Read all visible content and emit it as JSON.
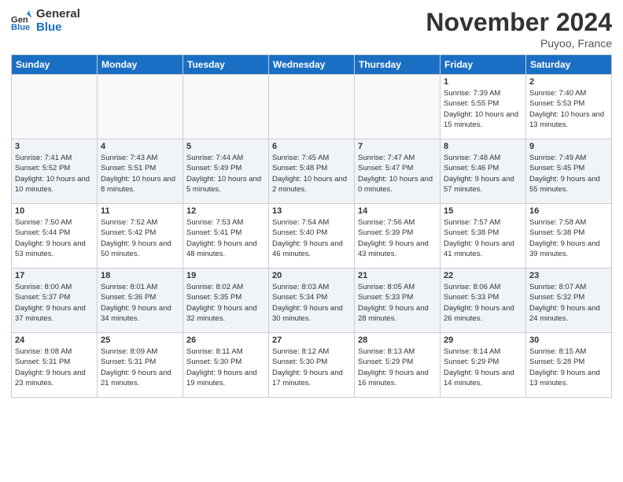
{
  "header": {
    "logo_line1": "General",
    "logo_line2": "Blue",
    "month": "November 2024",
    "location": "Puyoo, France"
  },
  "days_of_week": [
    "Sunday",
    "Monday",
    "Tuesday",
    "Wednesday",
    "Thursday",
    "Friday",
    "Saturday"
  ],
  "weeks": [
    [
      {
        "day": "",
        "info": ""
      },
      {
        "day": "",
        "info": ""
      },
      {
        "day": "",
        "info": ""
      },
      {
        "day": "",
        "info": ""
      },
      {
        "day": "",
        "info": ""
      },
      {
        "day": "1",
        "info": "Sunrise: 7:39 AM\nSunset: 5:55 PM\nDaylight: 10 hours and 15 minutes."
      },
      {
        "day": "2",
        "info": "Sunrise: 7:40 AM\nSunset: 5:53 PM\nDaylight: 10 hours and 13 minutes."
      }
    ],
    [
      {
        "day": "3",
        "info": "Sunrise: 7:41 AM\nSunset: 5:52 PM\nDaylight: 10 hours and 10 minutes."
      },
      {
        "day": "4",
        "info": "Sunrise: 7:43 AM\nSunset: 5:51 PM\nDaylight: 10 hours and 8 minutes."
      },
      {
        "day": "5",
        "info": "Sunrise: 7:44 AM\nSunset: 5:49 PM\nDaylight: 10 hours and 5 minutes."
      },
      {
        "day": "6",
        "info": "Sunrise: 7:45 AM\nSunset: 5:48 PM\nDaylight: 10 hours and 2 minutes."
      },
      {
        "day": "7",
        "info": "Sunrise: 7:47 AM\nSunset: 5:47 PM\nDaylight: 10 hours and 0 minutes."
      },
      {
        "day": "8",
        "info": "Sunrise: 7:48 AM\nSunset: 5:46 PM\nDaylight: 9 hours and 57 minutes."
      },
      {
        "day": "9",
        "info": "Sunrise: 7:49 AM\nSunset: 5:45 PM\nDaylight: 9 hours and 55 minutes."
      }
    ],
    [
      {
        "day": "10",
        "info": "Sunrise: 7:50 AM\nSunset: 5:44 PM\nDaylight: 9 hours and 53 minutes."
      },
      {
        "day": "11",
        "info": "Sunrise: 7:52 AM\nSunset: 5:42 PM\nDaylight: 9 hours and 50 minutes."
      },
      {
        "day": "12",
        "info": "Sunrise: 7:53 AM\nSunset: 5:41 PM\nDaylight: 9 hours and 48 minutes."
      },
      {
        "day": "13",
        "info": "Sunrise: 7:54 AM\nSunset: 5:40 PM\nDaylight: 9 hours and 46 minutes."
      },
      {
        "day": "14",
        "info": "Sunrise: 7:56 AM\nSunset: 5:39 PM\nDaylight: 9 hours and 43 minutes."
      },
      {
        "day": "15",
        "info": "Sunrise: 7:57 AM\nSunset: 5:38 PM\nDaylight: 9 hours and 41 minutes."
      },
      {
        "day": "16",
        "info": "Sunrise: 7:58 AM\nSunset: 5:38 PM\nDaylight: 9 hours and 39 minutes."
      }
    ],
    [
      {
        "day": "17",
        "info": "Sunrise: 8:00 AM\nSunset: 5:37 PM\nDaylight: 9 hours and 37 minutes."
      },
      {
        "day": "18",
        "info": "Sunrise: 8:01 AM\nSunset: 5:36 PM\nDaylight: 9 hours and 34 minutes."
      },
      {
        "day": "19",
        "info": "Sunrise: 8:02 AM\nSunset: 5:35 PM\nDaylight: 9 hours and 32 minutes."
      },
      {
        "day": "20",
        "info": "Sunrise: 8:03 AM\nSunset: 5:34 PM\nDaylight: 9 hours and 30 minutes."
      },
      {
        "day": "21",
        "info": "Sunrise: 8:05 AM\nSunset: 5:33 PM\nDaylight: 9 hours and 28 minutes."
      },
      {
        "day": "22",
        "info": "Sunrise: 8:06 AM\nSunset: 5:33 PM\nDaylight: 9 hours and 26 minutes."
      },
      {
        "day": "23",
        "info": "Sunrise: 8:07 AM\nSunset: 5:32 PM\nDaylight: 9 hours and 24 minutes."
      }
    ],
    [
      {
        "day": "24",
        "info": "Sunrise: 8:08 AM\nSunset: 5:31 PM\nDaylight: 9 hours and 23 minutes."
      },
      {
        "day": "25",
        "info": "Sunrise: 8:09 AM\nSunset: 5:31 PM\nDaylight: 9 hours and 21 minutes."
      },
      {
        "day": "26",
        "info": "Sunrise: 8:11 AM\nSunset: 5:30 PM\nDaylight: 9 hours and 19 minutes."
      },
      {
        "day": "27",
        "info": "Sunrise: 8:12 AM\nSunset: 5:30 PM\nDaylight: 9 hours and 17 minutes."
      },
      {
        "day": "28",
        "info": "Sunrise: 8:13 AM\nSunset: 5:29 PM\nDaylight: 9 hours and 16 minutes."
      },
      {
        "day": "29",
        "info": "Sunrise: 8:14 AM\nSunset: 5:29 PM\nDaylight: 9 hours and 14 minutes."
      },
      {
        "day": "30",
        "info": "Sunrise: 8:15 AM\nSunset: 5:28 PM\nDaylight: 9 hours and 13 minutes."
      }
    ]
  ]
}
